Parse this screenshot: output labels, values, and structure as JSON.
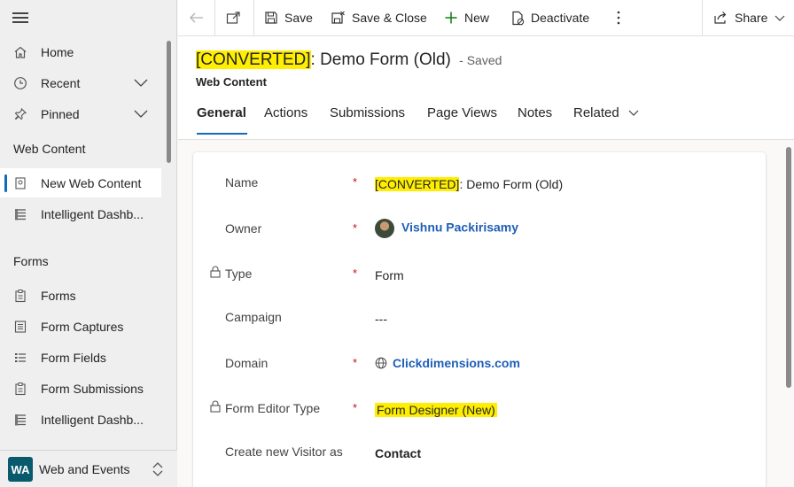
{
  "colors": {
    "accent": "#0f6cbd",
    "highlight": "#ffee00",
    "required": "#c50f1f",
    "link": "#1f5fb8",
    "area_badge": "#0a5a6e"
  },
  "sidebar": {
    "menu_icon": "hamburger-icon",
    "top_items": [
      {
        "label": "Home",
        "icon": "home-icon"
      },
      {
        "label": "Recent",
        "icon": "clock-icon"
      },
      {
        "label": "Pinned",
        "icon": "pin-icon"
      }
    ],
    "sections": [
      {
        "title": "Web Content",
        "items": [
          {
            "label": "New Web Content",
            "icon": "web-page-icon",
            "active": true
          },
          {
            "label": "Intelligent Dashb...",
            "icon": "dashboard-icon"
          }
        ]
      },
      {
        "title": "Forms",
        "items": [
          {
            "label": "Forms",
            "icon": "clipboard-icon"
          },
          {
            "label": "Form Captures",
            "icon": "list-icon"
          },
          {
            "label": "Form Fields",
            "icon": "bullet-list-icon"
          },
          {
            "label": "Form Submissions",
            "icon": "clipboard-icon"
          },
          {
            "label": "Intelligent Dashb...",
            "icon": "dashboard-icon"
          }
        ]
      }
    ],
    "area": {
      "badge": "WA",
      "label": "Web and Events"
    }
  },
  "commandbar": {
    "back_icon": "arrow-left-icon",
    "popout_icon": "open-in-window-icon",
    "save": "Save",
    "save_close": "Save & Close",
    "new": "New",
    "deactivate": "Deactivate",
    "more_icon": "more-vertical-icon",
    "share": "Share"
  },
  "header": {
    "title_highlight": "[CONVERTED]",
    "title_rest": ": Demo Form (Old)",
    "saved_status": "- Saved",
    "entity": "Web Content",
    "tabs": [
      "General",
      "Actions",
      "Submissions",
      "Page Views",
      "Notes",
      "Related"
    ]
  },
  "form": {
    "name": {
      "label": "Name",
      "value_highlight": "[CONVERTED]",
      "value_rest": ": Demo Form (Old)"
    },
    "owner": {
      "label": "Owner",
      "value": "Vishnu Packirisamy"
    },
    "type": {
      "label": "Type",
      "value": "Form"
    },
    "campaign": {
      "label": "Campaign",
      "value": "---"
    },
    "domain": {
      "label": "Domain",
      "value": "Clickdimensions.com"
    },
    "form_editor_type": {
      "label": "Form Editor Type",
      "value": "Form Designer (New)"
    },
    "create_visitor": {
      "label": "Create new Visitor as",
      "value": "Contact"
    },
    "required_mark": "*"
  }
}
